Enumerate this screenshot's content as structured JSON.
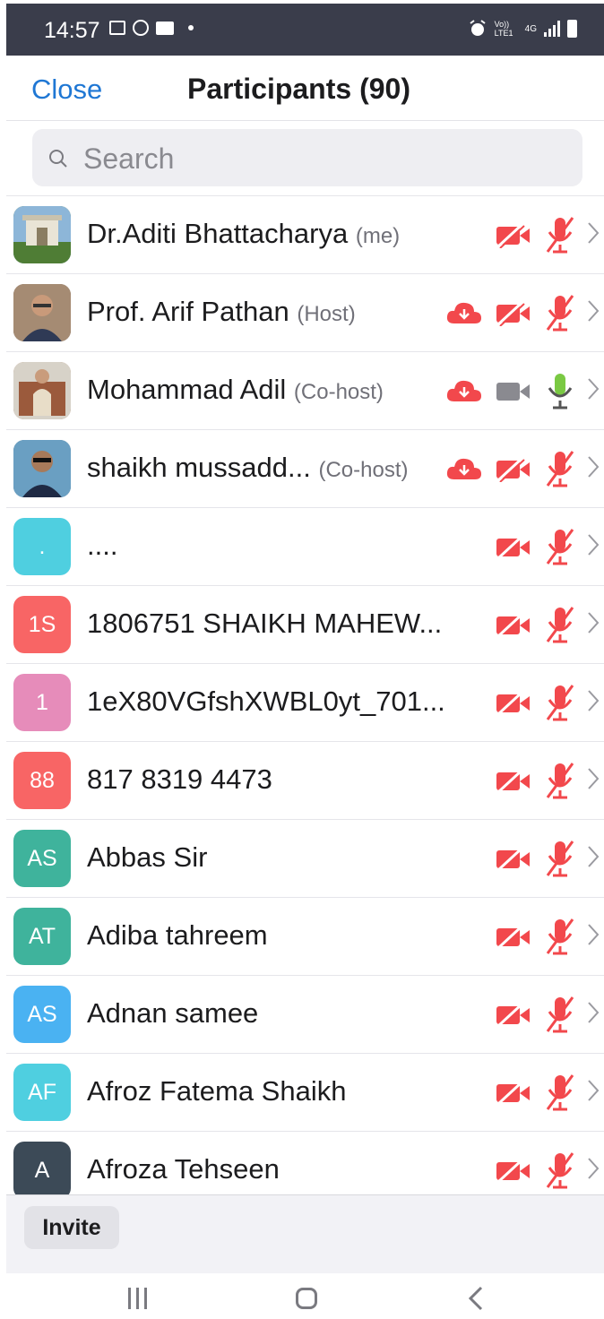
{
  "status_bar": {
    "time": "14:57",
    "network": "4G",
    "volte": "Vo)) LTE1"
  },
  "header": {
    "close_label": "Close",
    "title": "Participants (90)"
  },
  "search": {
    "placeholder": "Search"
  },
  "participants": [
    {
      "name": "Dr.Aditi Bhattacharya",
      "role": "(me)",
      "avatar_type": "photo-building",
      "cloud": false,
      "video": "off",
      "audio": "muted"
    },
    {
      "name": "Prof. Arif Pathan",
      "role": "(Host)",
      "avatar_type": "photo-person",
      "cloud": true,
      "video": "off",
      "audio": "muted"
    },
    {
      "name": "Mohammad Adil",
      "role": "(Co-host)",
      "avatar_type": "photo-monument",
      "cloud": true,
      "video": "available",
      "audio": "on"
    },
    {
      "name": "shaikh mussadd...",
      "role": "(Co-host)",
      "avatar_type": "photo-person",
      "cloud": true,
      "video": "off",
      "audio": "muted"
    },
    {
      "name": "....",
      "role": "",
      "initials": ".",
      "avatar_color": "#4fcfe0",
      "cloud": false,
      "video": "off",
      "audio": "muted"
    },
    {
      "name": "1806751 SHAIKH MAHEW...",
      "role": "",
      "initials": "1S",
      "avatar_color": "#f86565",
      "cloud": false,
      "video": "off",
      "audio": "muted"
    },
    {
      "name": "1eX80VGfshXWBL0yt_701...",
      "role": "",
      "initials": "1",
      "avatar_color": "#e68cba",
      "cloud": false,
      "video": "off",
      "audio": "muted"
    },
    {
      "name": "817 8319 4473",
      "role": "",
      "initials": "88",
      "avatar_color": "#f86565",
      "cloud": false,
      "video": "off",
      "audio": "muted"
    },
    {
      "name": "Abbas Sir",
      "role": "",
      "initials": "AS",
      "avatar_color": "#3fb39c",
      "cloud": false,
      "video": "off",
      "audio": "muted"
    },
    {
      "name": "Adiba tahreem",
      "role": "",
      "initials": "AT",
      "avatar_color": "#3fb39c",
      "cloud": false,
      "video": "off",
      "audio": "muted"
    },
    {
      "name": "Adnan samee",
      "role": "",
      "initials": "AS",
      "avatar_color": "#4ab2f2",
      "cloud": false,
      "video": "off",
      "audio": "muted"
    },
    {
      "name": "Afroz Fatema Shaikh",
      "role": "",
      "initials": "AF",
      "avatar_color": "#4fcfe0",
      "cloud": false,
      "video": "off",
      "audio": "muted"
    },
    {
      "name": "Afroza Tehseen",
      "role": "",
      "initials": "A",
      "avatar_color": "#3c4a57",
      "cloud": false,
      "video": "off",
      "audio": "muted"
    }
  ],
  "footer": {
    "invite_label": "Invite"
  },
  "colors": {
    "accent": "#1f77d4",
    "muted_red": "#f2484c",
    "mic_on_green": "#7ac943",
    "video_gray": "#8a8a90"
  }
}
